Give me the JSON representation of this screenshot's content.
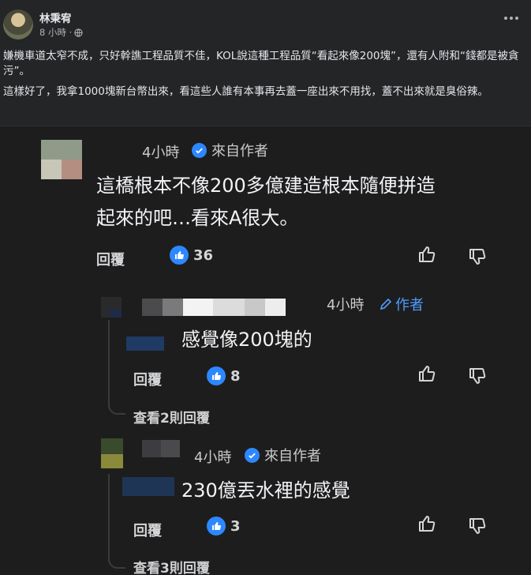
{
  "post": {
    "author": "林秉宥",
    "time": "8 小時 ·",
    "paragraph1": "嫌機車道太窄不成，只好幹譙工程品質不佳，KOL說這種工程品質“看起來像200塊”，還有人附和“錢都是被貪污”。",
    "paragraph2": "這樣好了，我拿1000塊新台幣出來，看這些人誰有本事再去蓋一座出來不用找，蓋不出來就是臭俗辣。",
    "icons": [
      "globe-icon",
      "more-icon"
    ]
  },
  "comments": [
    {
      "time": "4小時",
      "badge": "來自作者",
      "text_line1": "這橋根本不像200多億建造根本隨便拼造",
      "text_line2": "起來的吧…看來A很大。",
      "reply_label": "回覆",
      "likes": "36"
    },
    {
      "time": "4小時",
      "author_tag": "作者",
      "text": "感覺像200塊的",
      "reply_label": "回覆",
      "likes": "8",
      "view_replies": "查看2則回覆"
    },
    {
      "time": "4小時",
      "badge": "來自作者",
      "text": "230億丟水裡的感覺",
      "reply_label": "回覆",
      "likes": "3",
      "view_replies": "查看3則回覆"
    }
  ],
  "colors": {
    "accent": "#2d88ff",
    "background": "#1d1d1e",
    "post_bg": "#242526"
  }
}
